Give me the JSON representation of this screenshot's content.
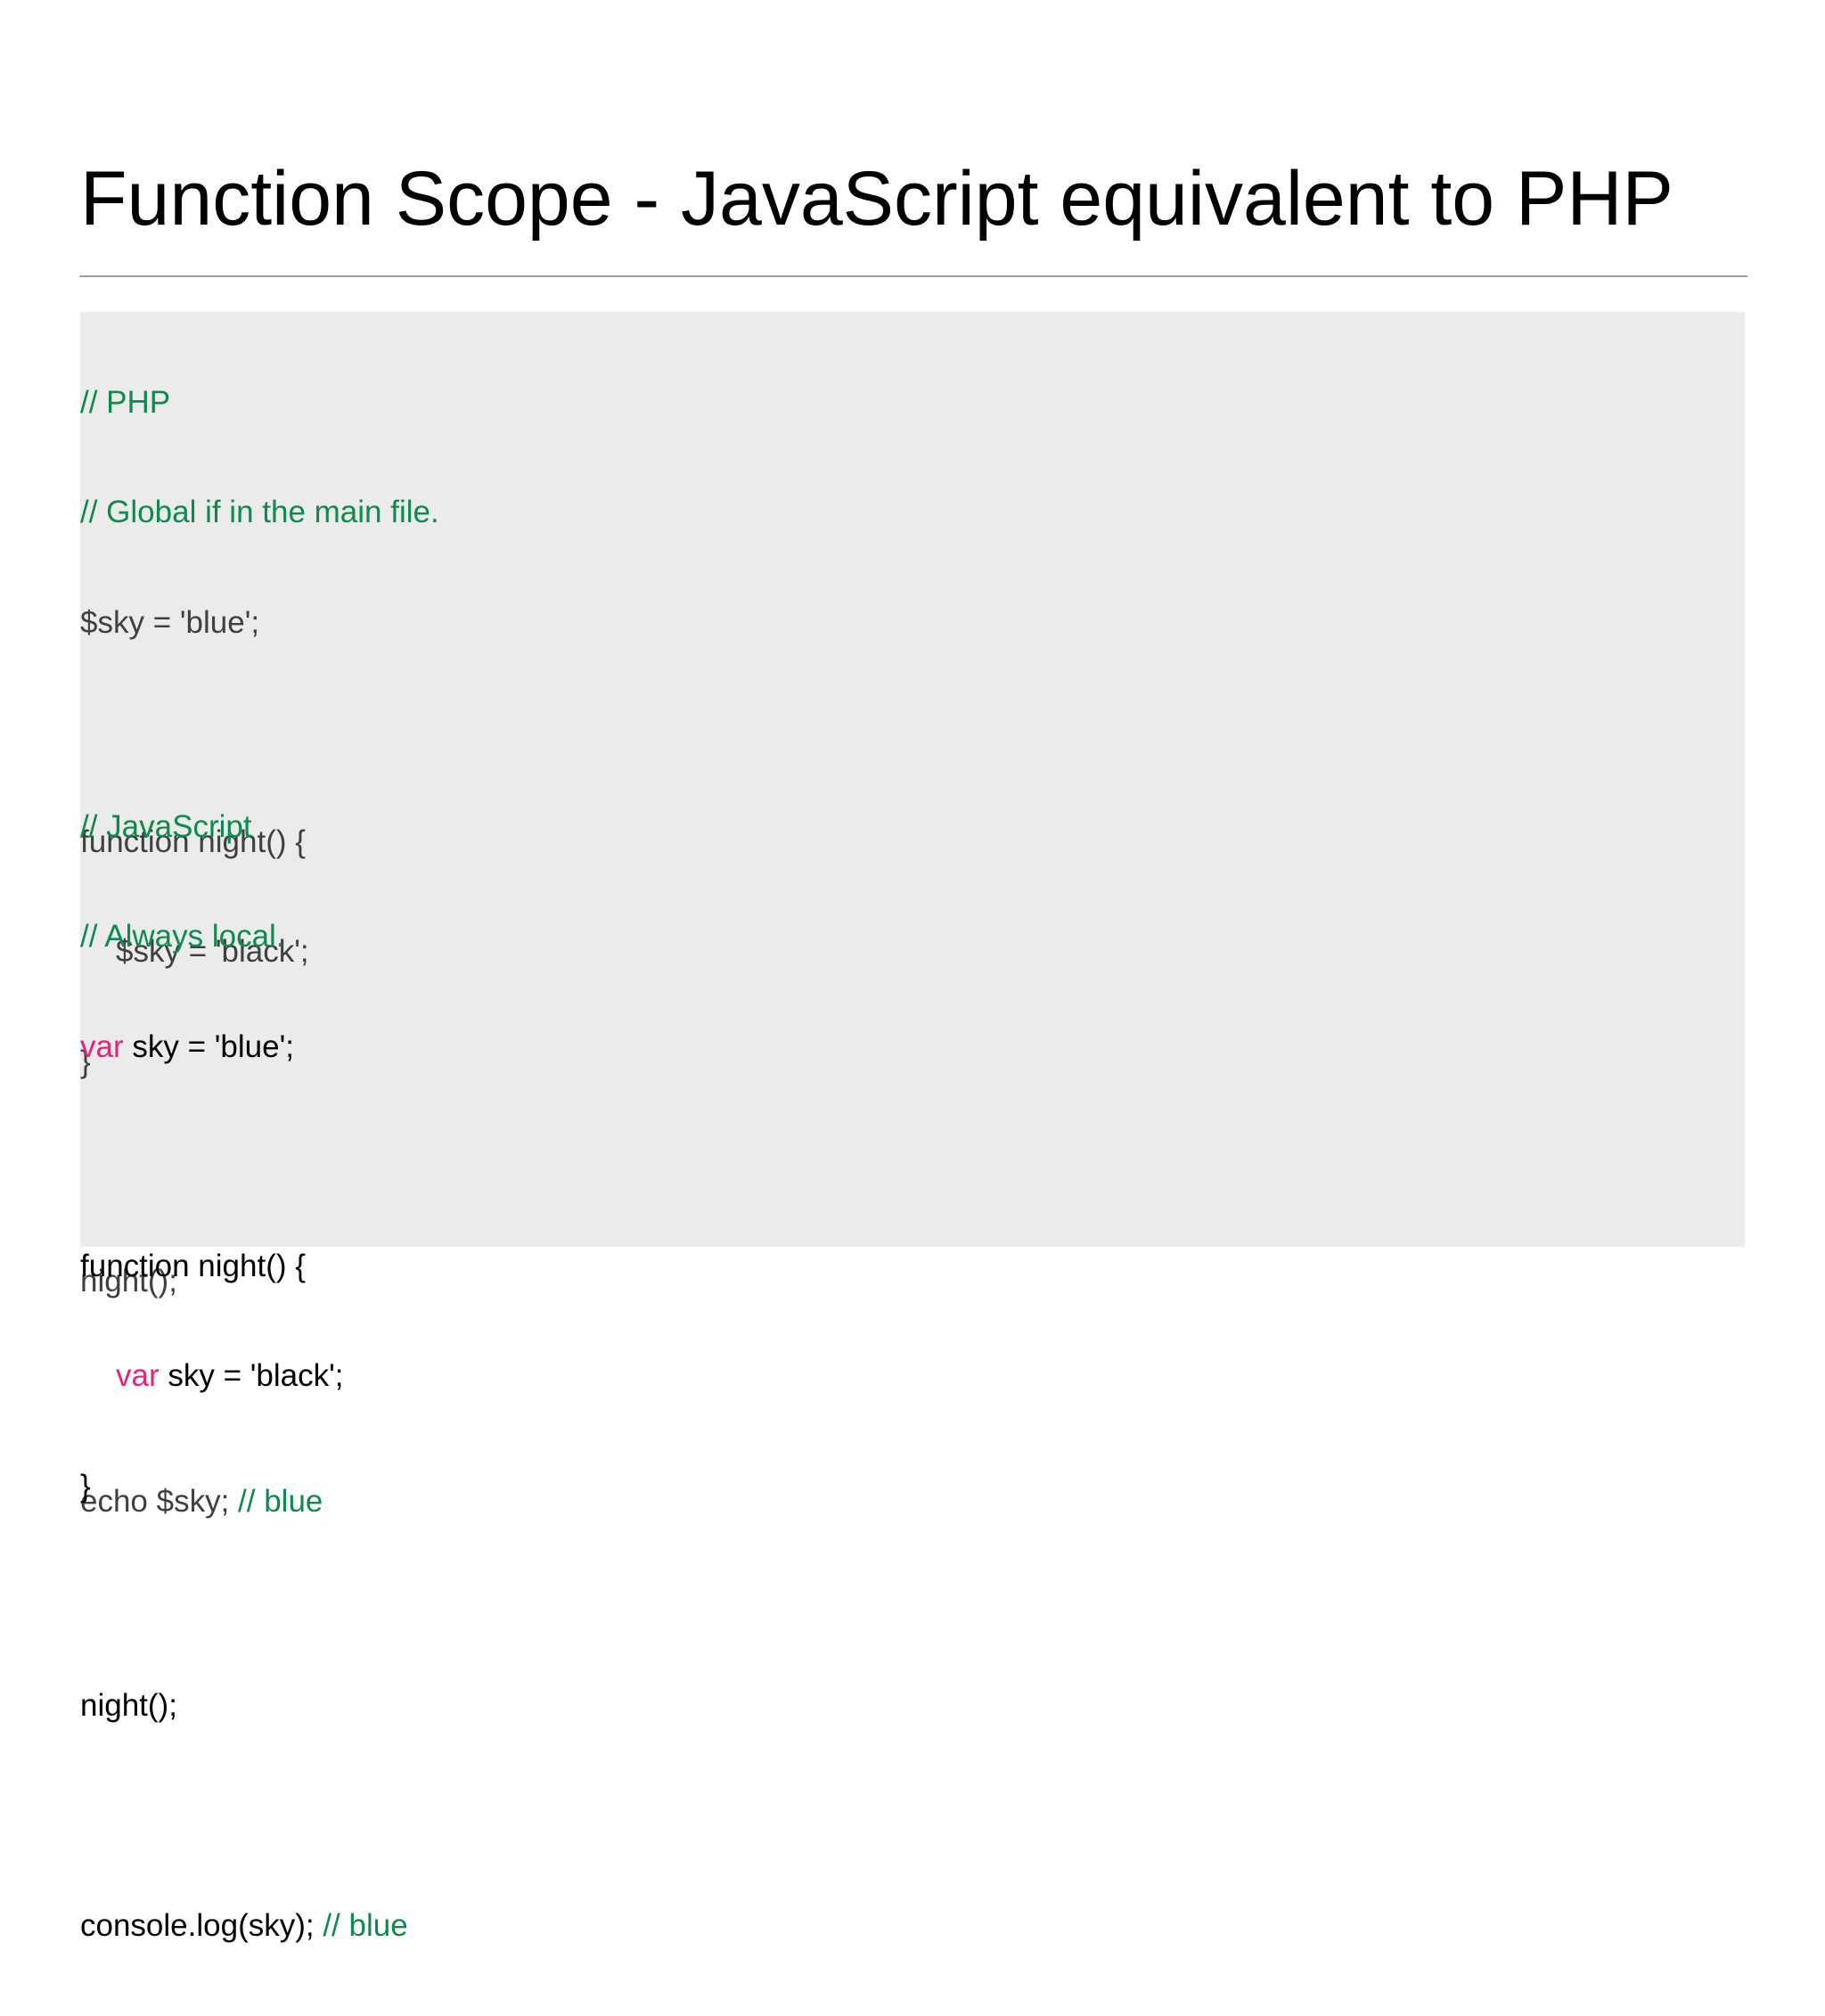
{
  "slide": {
    "title": "Function Scope - JavaScript equivalent to PHP"
  },
  "colors": {
    "comment": "#0f8a4e",
    "keyword": "#e8227a",
    "php_code": "#404040",
    "js_code": "#000000",
    "panel_background": "#ebebec",
    "rule": "#9e9e9e"
  },
  "php": {
    "comment1": "// PHP",
    "comment2": "// Global if in the main file.",
    "assign": "$sky = 'blue';",
    "fn_open": "function night() {",
    "fn_body": "$sky = 'black';",
    "fn_close": "}",
    "call": "night();",
    "echo_code": "echo $sky; ",
    "echo_comment": "// blue"
  },
  "js": {
    "comment1": "// JavaScript",
    "comment2": "// Always local.",
    "var_kw": "var",
    "assign_rest": " sky = 'blue';",
    "fn_open": "function night() {",
    "fn_body_kw": "var",
    "fn_body_rest": " sky = 'black';",
    "fn_close": "}",
    "call": "night();",
    "log_code": "console.log(sky); ",
    "log_comment": "// blue"
  }
}
